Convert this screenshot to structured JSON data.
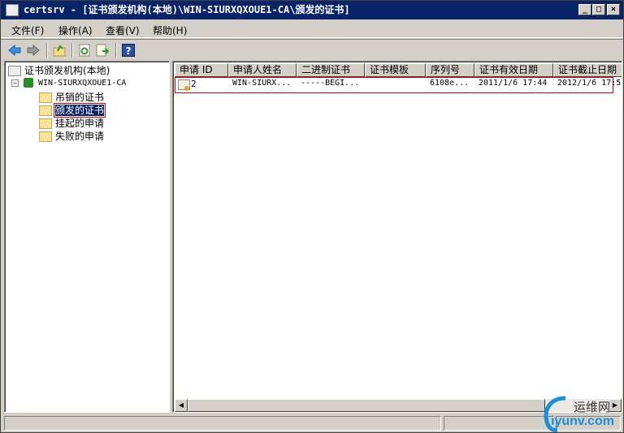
{
  "window": {
    "title": "certsrv - [证书颁发机构(本地)\\WIN-SIURXQXOUE1-CA\\颁发的证书]"
  },
  "menu": [
    "文件(F)",
    "操作(A)",
    "查看(V)",
    "帮助(H)"
  ],
  "toolbar": [
    "back-icon",
    "forward-icon",
    "up-folder-icon",
    "refresh-icon",
    "export-list-icon",
    "help-icon"
  ],
  "tree": {
    "root": "证书颁发机构(本地)",
    "ca": "WIN-SIURXQXOUE1-CA",
    "expander": "−",
    "folders": [
      "吊销的证书",
      "颁发的证书",
      "挂起的申请",
      "失败的申请"
    ],
    "selected": "颁发的证书"
  },
  "table": {
    "columns": [
      "申请 ID",
      "申请人姓名",
      "二进制证书",
      "证书模板",
      "序列号",
      "证书有效日期",
      "证书截止日期"
    ],
    "rows": [
      [
        "2",
        "WIN-SIURX...",
        "-----BEGI...",
        "",
        "6108e...",
        "2011/1/6 17:44",
        "2012/1/6 17:5"
      ]
    ]
  },
  "watermark": {
    "cn": "运维网",
    "url": "iyunv.com"
  },
  "colors": {
    "titlebar": "#0a246a",
    "highlight": "#e00000",
    "selection": "#0a246a"
  }
}
